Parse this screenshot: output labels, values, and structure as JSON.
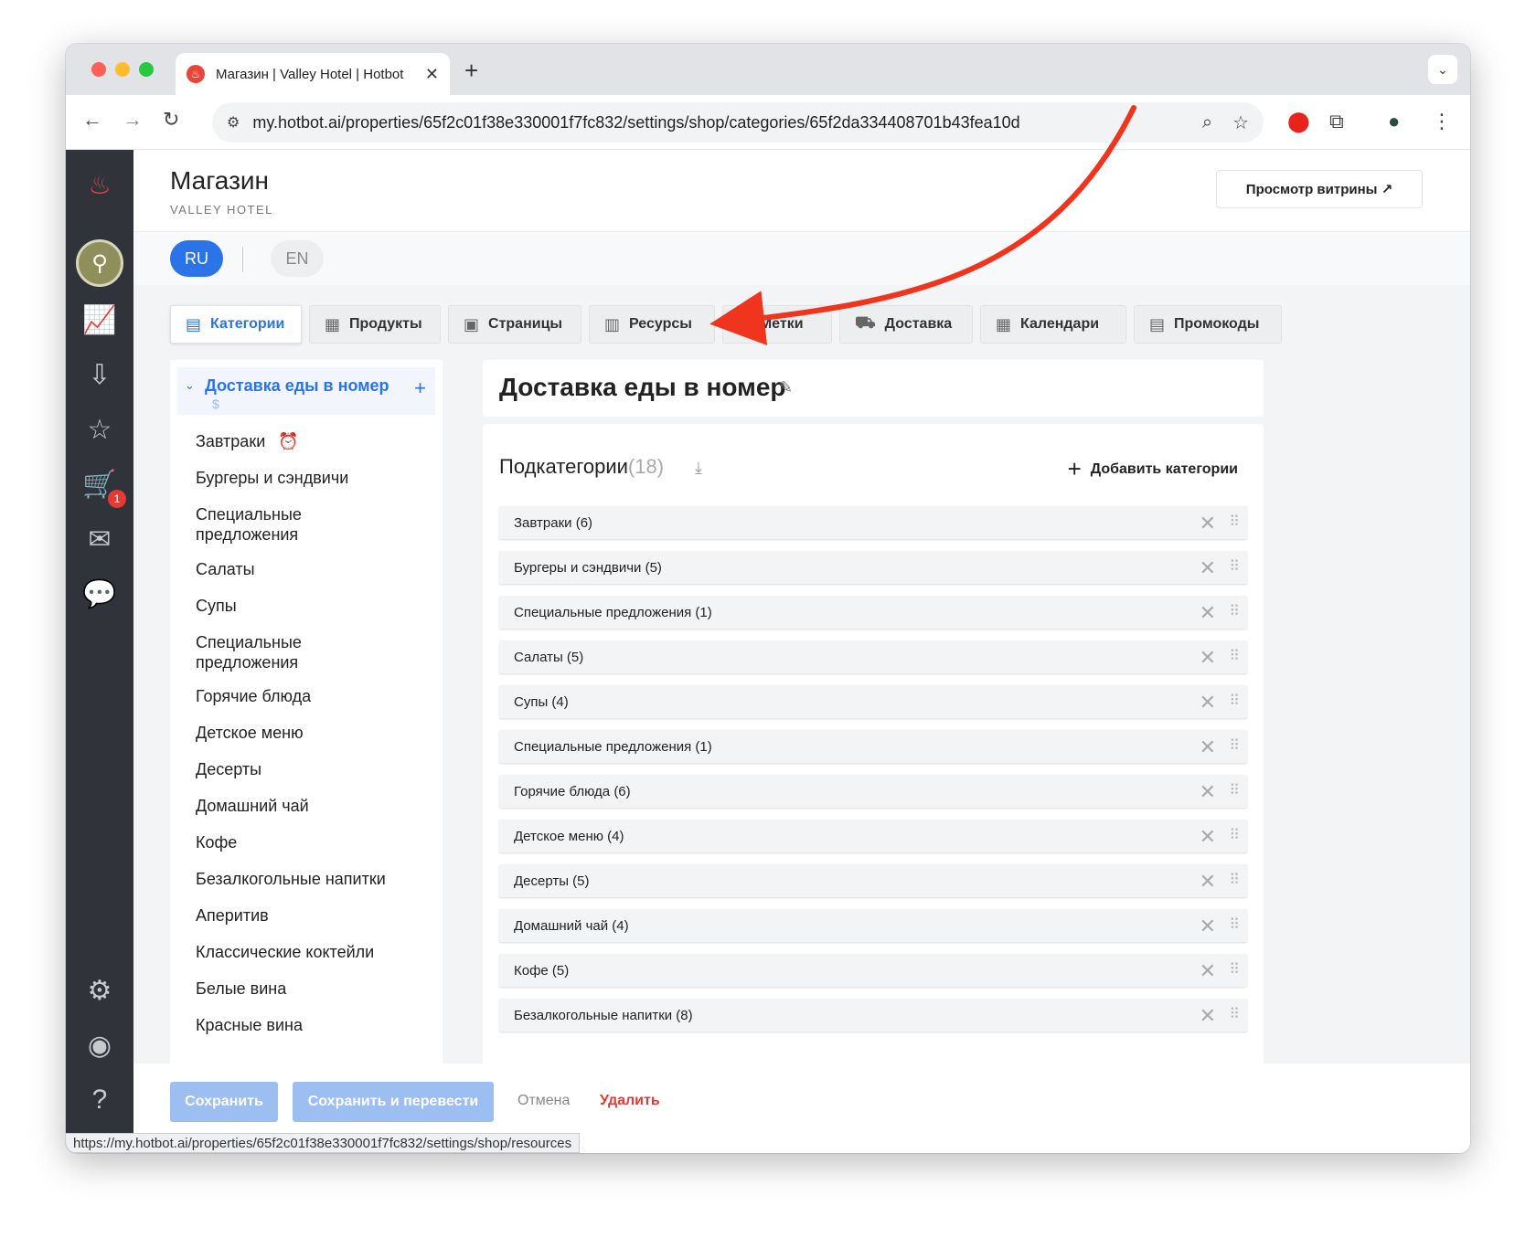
{
  "browser": {
    "tab_title": "Магазин | Valley Hotel | Hotbot",
    "tab_favicon": "flame-icon",
    "url": "my.hotbot.ai/properties/65f2c01f38e330001f7fc832/settings/shop/categories/65f2da334408701b43fea10d",
    "status_url": "https://my.hotbot.ai/properties/65f2c01f38e330001f7fc832/settings/shop/resources"
  },
  "header": {
    "title": "Магазин",
    "subtitle": "VALLEY HOTEL",
    "view_button": "Просмотр витрины ↗"
  },
  "languages": {
    "ru": "RU",
    "en": "EN"
  },
  "nav_tabs": [
    {
      "label": "Категории",
      "icon": "store-icon",
      "active": true
    },
    {
      "label": "Продукты",
      "icon": "widgets-icon"
    },
    {
      "label": "Страницы",
      "icon": "page-icon"
    },
    {
      "label": "Ресурсы",
      "icon": "resources-icon"
    },
    {
      "label": "Метки",
      "icon": "tag-icon"
    },
    {
      "label": "Доставка",
      "icon": "truck-icon"
    },
    {
      "label": "Календари",
      "icon": "calendar-icon"
    },
    {
      "label": "Промокоды",
      "icon": "promo-icon"
    }
  ],
  "category_tree": {
    "root": "Доставка еды в номер",
    "root_badge": "$",
    "items": [
      "Завтраки",
      "Бургеры и сэндвичи",
      "Специальные предложения",
      "Салаты",
      "Супы",
      "Специальные предложения",
      "Горячие блюда",
      "Детское меню",
      "Десерты",
      "Домашний чай",
      "Кофе",
      "Безалкогольные напитки",
      "Аперитив",
      "Классические коктейли",
      "Белые вина",
      "Красные вина"
    ]
  },
  "main": {
    "title": "Доставка еды в номер",
    "subcategories_label": "Подкатегории",
    "subcategories_count": "(18)",
    "add_button": "Добавить категории",
    "rows": [
      "Завтраки (6)",
      "Бургеры и сэндвичи (5)",
      "Специальные предложения (1)",
      "Салаты (5)",
      "Супы (4)",
      "Специальные предложения (1)",
      "Горячие блюда (6)",
      "Детское меню (4)",
      "Десерты (5)",
      "Домашний чай (4)",
      "Кофе (5)",
      "Безалкогольные напитки (8)"
    ]
  },
  "footer": {
    "save": "Сохранить",
    "save_translate": "Сохранить и перевести",
    "cancel": "Отмена",
    "delete": "Удалить"
  },
  "colors": {
    "accent": "#2a73e8",
    "rail": "#30333a",
    "danger": "#e53935",
    "annotation_arrow": "#f0341e"
  },
  "cart_badge": "1"
}
